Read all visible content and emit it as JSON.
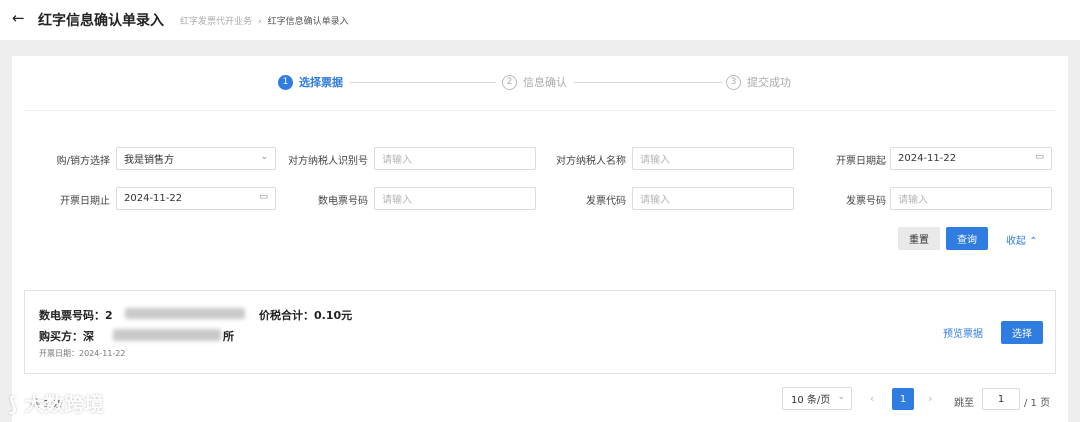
{
  "header": {
    "back_icon": "arrow-left-icon",
    "title": "红字信息确认单录入",
    "breadcrumb": [
      "红字发票代开业务",
      "红字信息确认单录入"
    ]
  },
  "steps": [
    {
      "num": "1",
      "label": "选择票据",
      "active": true
    },
    {
      "num": "2",
      "label": "信息确认",
      "active": false
    },
    {
      "num": "3",
      "label": "提交成功",
      "active": false
    }
  ],
  "form": {
    "buyer_seller_label": "购/销方选择",
    "buyer_seller_value": "我是销售方",
    "tax_id_label": "对方纳税人识别号",
    "tax_id_placeholder": "请输入",
    "tax_name_label": "对方纳税人名称",
    "tax_name_placeholder": "请输入",
    "date_start_label": "开票日期起",
    "date_start_value": "2024-11-22",
    "date_end_label": "开票日期止",
    "date_end_value": "2024-11-22",
    "einvoice_no_label": "数电票号码",
    "einvoice_no_placeholder": "请输入",
    "invoice_code_label": "发票代码",
    "invoice_code_placeholder": "请输入",
    "invoice_no_label": "发票号码",
    "invoice_no_placeholder": "请输入",
    "reset_label": "重置",
    "query_label": "查询",
    "collapse_label": "收起"
  },
  "result": {
    "einvoice_label": "数电票号码：2",
    "total_label": "价税合计：0.10元",
    "buyer_label": "购买方：深",
    "buyer_suffix": "所",
    "date_label": "开票日期：2024-11-22",
    "preview_label": "预览票据",
    "select_label": "选择"
  },
  "pager": {
    "total_label": "共 1 条",
    "page_size": "10 条/页",
    "current_page": "1",
    "jump_label": "跳至",
    "jump_value": "1",
    "total_pages": "/ 1 页"
  },
  "watermark": "大数跨境"
}
